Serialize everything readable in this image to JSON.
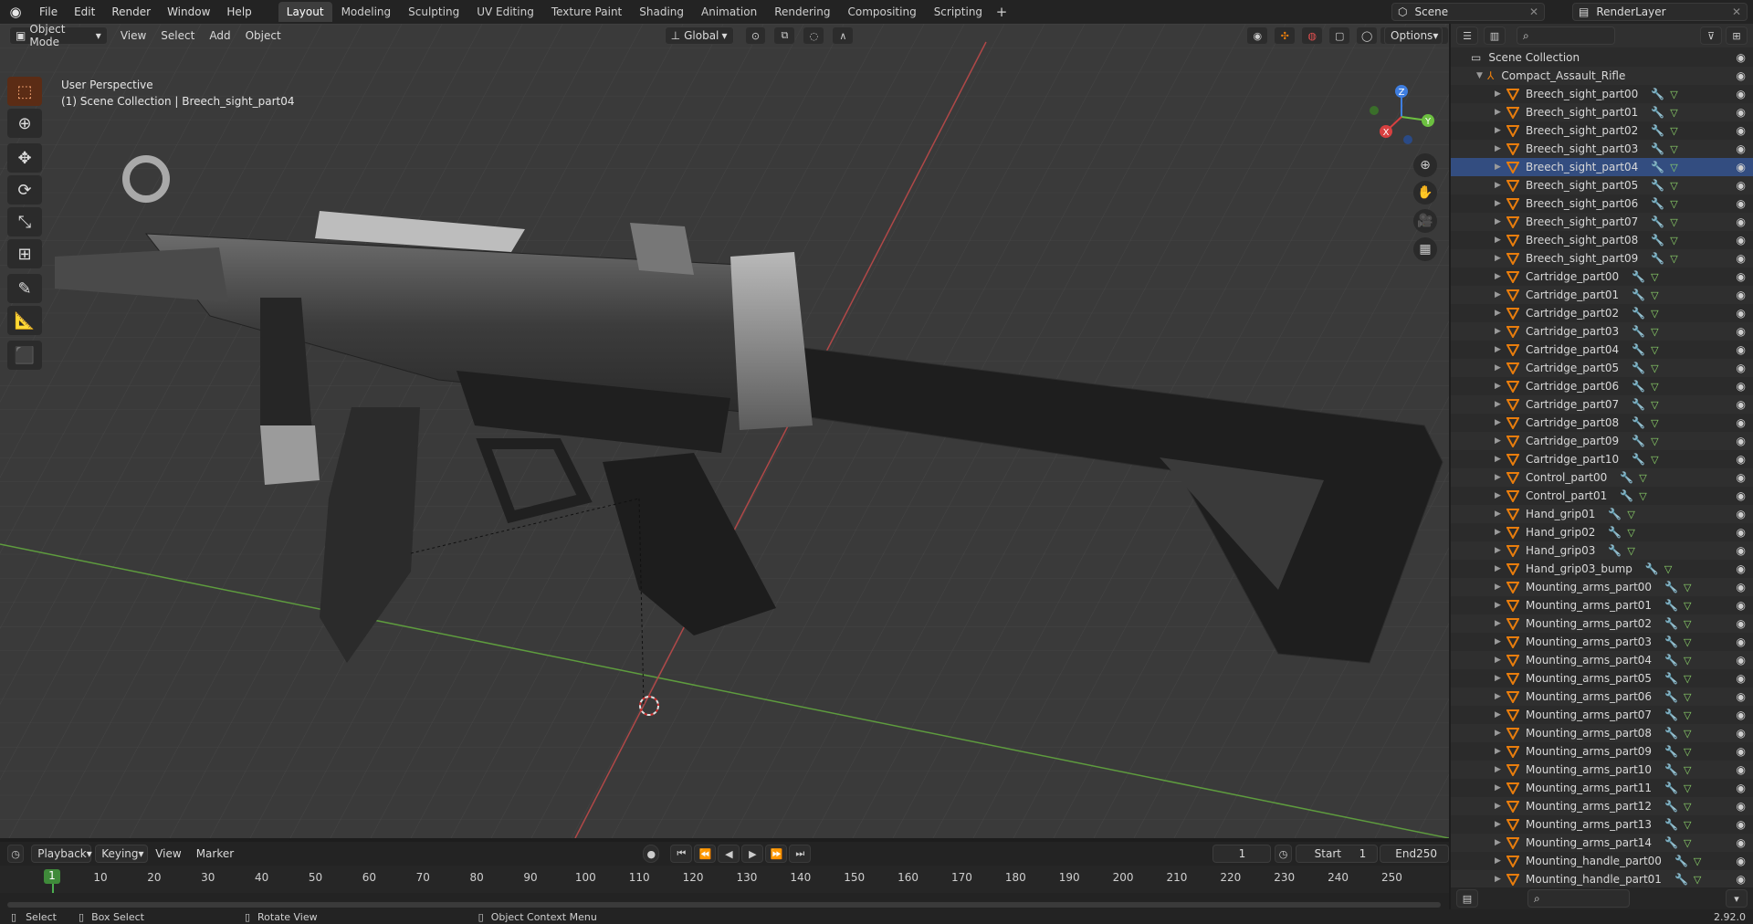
{
  "menu": [
    "File",
    "Edit",
    "Render",
    "Window",
    "Help"
  ],
  "workspaces": [
    {
      "label": "Layout",
      "active": true
    },
    {
      "label": "Modeling",
      "active": false
    },
    {
      "label": "Sculpting",
      "active": false
    },
    {
      "label": "UV Editing",
      "active": false
    },
    {
      "label": "Texture Paint",
      "active": false
    },
    {
      "label": "Shading",
      "active": false
    },
    {
      "label": "Animation",
      "active": false
    },
    {
      "label": "Rendering",
      "active": false
    },
    {
      "label": "Compositing",
      "active": false
    },
    {
      "label": "Scripting",
      "active": false
    }
  ],
  "scene_name": "Scene",
  "view_layer": "RenderLayer",
  "viewport": {
    "mode": "Object Mode",
    "menus": [
      "View",
      "Select",
      "Add",
      "Object"
    ],
    "orientation": "Global",
    "options": "Options",
    "perspective_label": "User Perspective",
    "collection_label": "(1) Scene Collection | Breech_sight_part04"
  },
  "timeline": {
    "menus": [
      "Playback",
      "Keying",
      "View",
      "Marker"
    ],
    "current_frame": "1",
    "start_label": "Start",
    "start": "1",
    "end_label": "End",
    "end": "250",
    "ticks": [
      "1",
      "10",
      "20",
      "30",
      "40",
      "50",
      "60",
      "70",
      "80",
      "90",
      "100",
      "110",
      "120",
      "130",
      "140",
      "150",
      "160",
      "170",
      "180",
      "190",
      "200",
      "210",
      "220",
      "230",
      "240",
      "250"
    ]
  },
  "status": {
    "select": "Select",
    "box_select": "Box Select",
    "rotate": "Rotate View",
    "context": "Object Context Menu",
    "version": "2.92.0"
  },
  "outliner": {
    "root": "Scene Collection",
    "collection": "Compact_Assault_Rifle",
    "items": [
      "Breech_sight_part00",
      "Breech_sight_part01",
      "Breech_sight_part02",
      "Breech_sight_part03",
      "Breech_sight_part04",
      "Breech_sight_part05",
      "Breech_sight_part06",
      "Breech_sight_part07",
      "Breech_sight_part08",
      "Breech_sight_part09",
      "Cartridge_part00",
      "Cartridge_part01",
      "Cartridge_part02",
      "Cartridge_part03",
      "Cartridge_part04",
      "Cartridge_part05",
      "Cartridge_part06",
      "Cartridge_part07",
      "Cartridge_part08",
      "Cartridge_part09",
      "Cartridge_part10",
      "Control_part00",
      "Control_part01",
      "Hand_grip01",
      "Hand_grip02",
      "Hand_grip03",
      "Hand_grip03_bump",
      "Mounting_arms_part00",
      "Mounting_arms_part01",
      "Mounting_arms_part02",
      "Mounting_arms_part03",
      "Mounting_arms_part04",
      "Mounting_arms_part05",
      "Mounting_arms_part06",
      "Mounting_arms_part07",
      "Mounting_arms_part08",
      "Mounting_arms_part09",
      "Mounting_arms_part10",
      "Mounting_arms_part11",
      "Mounting_arms_part12",
      "Mounting_arms_part13",
      "Mounting_arms_part14",
      "Mounting_handle_part00",
      "Mounting_handle_part01"
    ],
    "selected": "Breech_sight_part04"
  },
  "colors": {
    "accent": "#e87d0d",
    "selection": "#334d80",
    "x_axis": "#d84040",
    "y_axis": "#6cc040",
    "z_axis": "#3f7ee0"
  }
}
